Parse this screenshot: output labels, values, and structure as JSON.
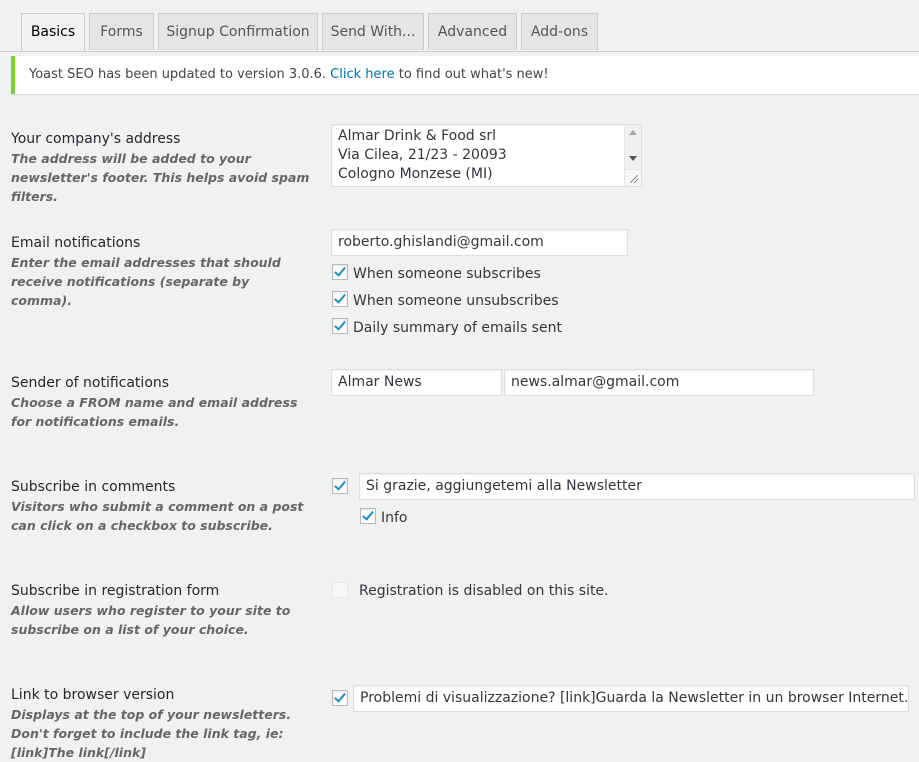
{
  "tabs": [
    {
      "label": "Basics",
      "active": true
    },
    {
      "label": "Forms"
    },
    {
      "label": "Signup Confirmation"
    },
    {
      "label": "Send With..."
    },
    {
      "label": "Advanced"
    },
    {
      "label": "Add-ons"
    }
  ],
  "notice": {
    "text_before": "Yoast SEO has been updated to version 3.0.6.",
    "link": "Click here",
    "text_after": "to find out what's new!",
    "accent_color": "#7ad03a"
  },
  "company_address": {
    "title": "Your company's address",
    "description": "The address will be added to your newsletter's footer. This helps avoid spam filters.",
    "lines": [
      "Almar Drink & Food srl",
      "Via Cilea, 21/23 - 20093",
      "Cologno Monzese (MI)"
    ]
  },
  "email_notifications": {
    "title": "Email notifications",
    "description": "Enter the email addresses that should receive notifications (separate by comma).",
    "value": "roberto.ghislandi@gmail.com",
    "options": [
      {
        "label": "When someone subscribes",
        "checked": true
      },
      {
        "label": "When someone unsubscribes",
        "checked": true
      },
      {
        "label": "Daily summary of emails sent",
        "checked": true
      }
    ]
  },
  "sender": {
    "title": "Sender of notifications",
    "description": "Choose a FROM name and email address for notifications emails.",
    "name_value": "Almar News",
    "email_value": "news.almar@gmail.com"
  },
  "subscribe_comments": {
    "title": "Subscribe in comments",
    "description": "Visitors who submit a comment on a post can click on a checkbox to subscribe.",
    "checked": true,
    "text_value": "Si grazie, aggiungetemi alla Newsletter",
    "info_label": "Info",
    "info_checked": true
  },
  "subscribe_registration": {
    "title": "Subscribe in registration form",
    "description": "Allow users who register to your site to subscribe on a list of your choice.",
    "status": "Registration is disabled on this site."
  },
  "browser_link": {
    "title": "Link to browser version",
    "description": "Displays at the top of your newsletters. Don't forget to include the link tag, ie: [link]The link[/link]",
    "checked": true,
    "text_value": "Problemi di visualizzazione? [link]Guarda la Newsletter in un browser Internet.[/link]"
  }
}
